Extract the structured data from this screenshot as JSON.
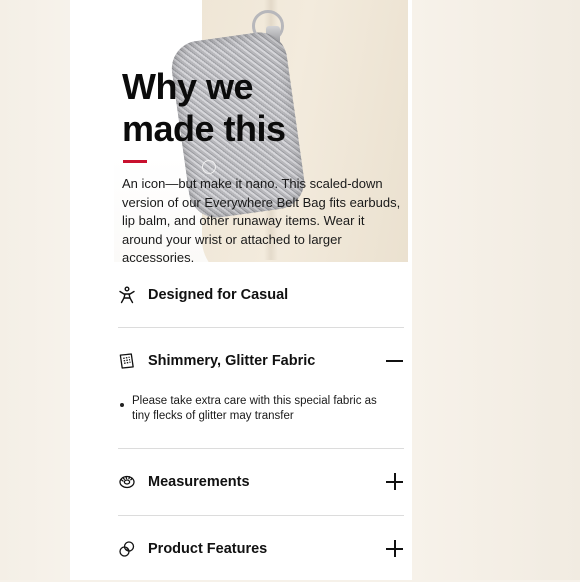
{
  "hero": {
    "title_line1": "Why we",
    "title_line2": "made this",
    "accent_color": "#c8102e",
    "description": "An icon—but make it nano. This scaled-down version of our Everywhere Belt Bag fits earbuds, lip balm, and other runaway items. Wear it around your wrist or attached to larger accessories."
  },
  "accordion": {
    "items": [
      {
        "label": "Designed for Casual",
        "icon": "person-activity-icon",
        "expanded": false,
        "toggle": "none"
      },
      {
        "label": "Shimmery, Glitter Fabric",
        "icon": "fabric-swatch-icon",
        "expanded": true,
        "toggle": "minus",
        "body": "Please take extra care with this special fabric as tiny flecks of glitter may transfer"
      },
      {
        "label": "Measurements",
        "icon": "measuring-tape-icon",
        "expanded": false,
        "toggle": "plus"
      },
      {
        "label": "Product Features",
        "icon": "features-icon",
        "expanded": false,
        "toggle": "plus"
      }
    ]
  }
}
